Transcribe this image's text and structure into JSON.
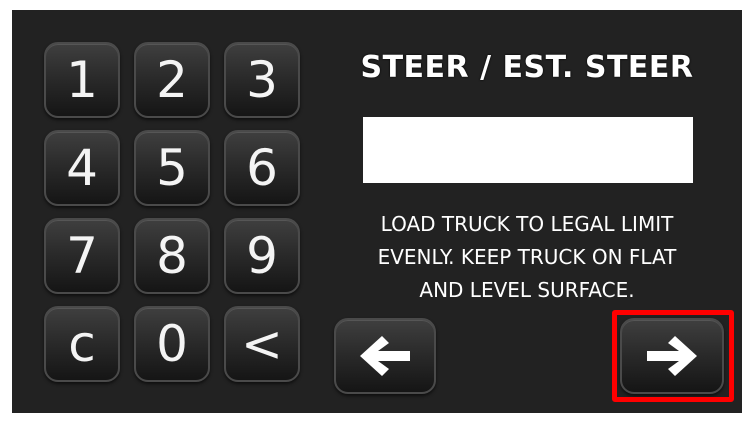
{
  "keypad": {
    "keys": [
      "1",
      "2",
      "3",
      "4",
      "5",
      "6",
      "7",
      "8",
      "9",
      "c",
      "0",
      "<"
    ]
  },
  "panel": {
    "title": "STEER / EST. STEER",
    "entry_value": "",
    "instructions": [
      "LOAD TRUCK TO LEGAL LIMIT",
      "EVENLY. KEEP TRUCK ON FLAT",
      "AND LEVEL SURFACE."
    ]
  },
  "navigation": {
    "back_icon": "arrow-left-icon",
    "next_icon": "arrow-right-icon",
    "highlight_color": "#ff0000"
  },
  "colors": {
    "screen_background": "#222222",
    "key_face": "#2b2b2b",
    "text": "#ffffff",
    "entry_background": "#ffffff"
  }
}
